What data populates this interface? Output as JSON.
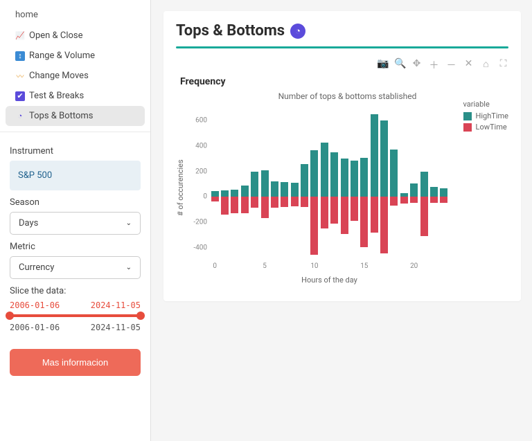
{
  "nav": {
    "home": "home",
    "items": [
      {
        "icon": "📈",
        "label": "Open & Close"
      },
      {
        "icon": "↕",
        "iconBg": "#3b8bd4",
        "label": "Range & Volume"
      },
      {
        "icon": "〰",
        "iconColor": "#e6a23c",
        "label": "Change Moves"
      },
      {
        "icon": "✔",
        "iconBg": "#5b4bdb",
        "label": "Test & Breaks"
      },
      {
        "icon": "◔",
        "iconColor": "#5b4bdb",
        "label": "Tops & Bottoms",
        "active": true
      }
    ]
  },
  "controls": {
    "instrumentLabel": "Instrument",
    "instrumentValue": "S&P 500",
    "seasonLabel": "Season",
    "seasonValue": "Days",
    "metricLabel": "Metric",
    "metricValue": "Currency",
    "sliceLabel": "Slice the data:",
    "sliceStart": "2006-01-06",
    "sliceEnd": "2024-11-05",
    "moreButton": "Mas informacion"
  },
  "page": {
    "title": "Tops & Bottoms",
    "subhead": "Frequency"
  },
  "toolbar": {
    "items": [
      {
        "name": "camera-icon",
        "glyph": "📷"
      },
      {
        "name": "zoom-icon",
        "glyph": "🔍",
        "active": true
      },
      {
        "name": "pan-icon",
        "glyph": "✥"
      },
      {
        "name": "zoom-in-icon",
        "glyph": "＋"
      },
      {
        "name": "zoom-out-icon",
        "glyph": "－"
      },
      {
        "name": "autoscale-icon",
        "glyph": "✕"
      },
      {
        "name": "reset-icon",
        "glyph": "⌂"
      },
      {
        "name": "fullscreen-icon",
        "glyph": "⛶"
      }
    ]
  },
  "chart_data": {
    "type": "bar",
    "title": "Number of tops & bottoms stablished",
    "xlabel": "Hours of the day",
    "ylabel": "# of occurencies",
    "categories": [
      0,
      1,
      2,
      3,
      4,
      5,
      6,
      7,
      8,
      9,
      10,
      11,
      12,
      13,
      14,
      15,
      16,
      17,
      18,
      19,
      20,
      21,
      22,
      23
    ],
    "xticks": [
      0,
      5,
      10,
      15,
      20
    ],
    "ylim": [
      -500,
      700
    ],
    "yticks": [
      -400,
      -200,
      0,
      200,
      400,
      600
    ],
    "legend_title": "variable",
    "series": [
      {
        "name": "HighTime",
        "color": "#2a8f88",
        "values": [
          45,
          50,
          55,
          90,
          200,
          210,
          120,
          115,
          110,
          260,
          370,
          430,
          350,
          300,
          285,
          310,
          650,
          600,
          375,
          30,
          105,
          200,
          80,
          65,
          50
        ]
      },
      {
        "name": "LowTime",
        "color": "#d94455",
        "values": [
          -35,
          -140,
          -130,
          -130,
          -85,
          -170,
          -85,
          -80,
          -75,
          -80,
          -455,
          -250,
          -210,
          -295,
          -190,
          -395,
          -280,
          -445,
          -70,
          -55,
          -50,
          -310,
          -50,
          -50,
          -40
        ]
      }
    ]
  }
}
